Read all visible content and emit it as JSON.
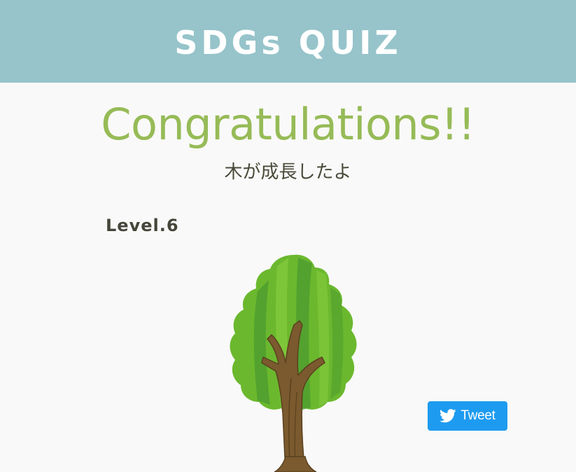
{
  "header": {
    "title": "SDGs QUIZ"
  },
  "result": {
    "heading": "Congratulations!!",
    "message": "木が成長したよ",
    "level": "Level.6"
  },
  "illustration": {
    "icon": "tree-icon"
  },
  "share": {
    "tweet_label": "Tweet",
    "icon": "twitter-bird-icon"
  },
  "colors": {
    "header_bg": "#96c4ca",
    "heading": "#96bb57",
    "text": "#4a4a3a",
    "tweet_button": "#1d9bf0",
    "page_bg": "#f9f9f9"
  }
}
